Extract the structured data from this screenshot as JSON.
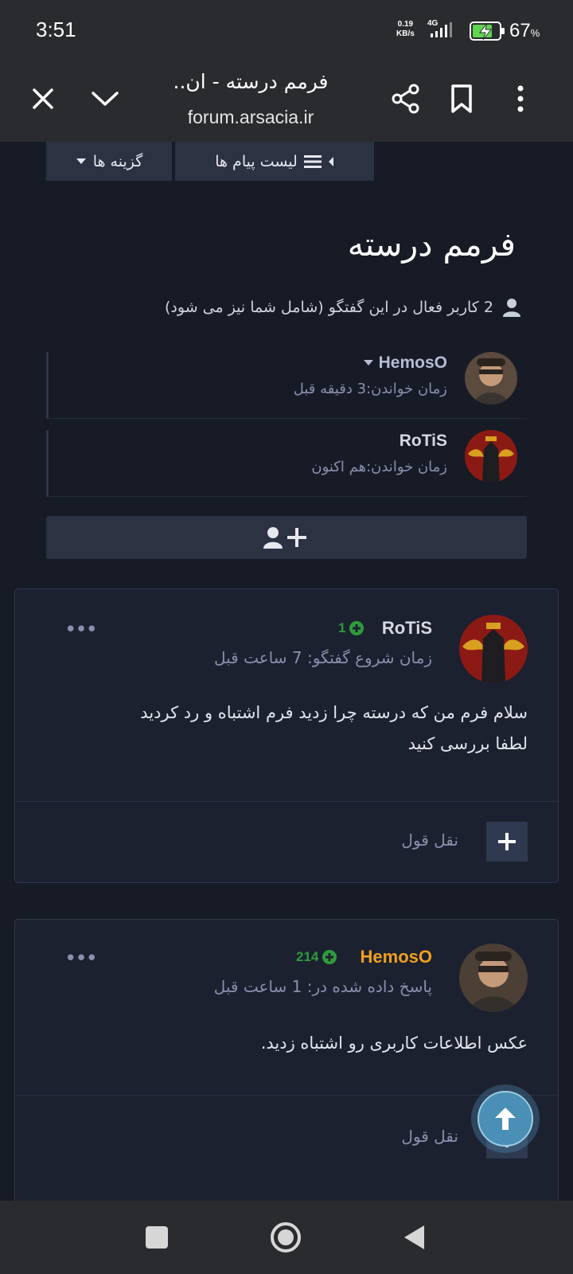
{
  "status": {
    "time": "3:51",
    "speed_value": "0.19",
    "speed_unit": "KB/s",
    "network": "4G",
    "battery": "67",
    "battery_unit": "%"
  },
  "browser": {
    "title": "فرمم درسته - ان..",
    "url": "forum.arsacia.ir",
    "icons": [
      "close-icon",
      "chevron-down-icon",
      "share-icon",
      "bookmark-icon",
      "more-vert-icon"
    ]
  },
  "topbar": {
    "options_label": "گزینه ها",
    "messages_label": "لیست پیام ها"
  },
  "thread": {
    "title": "فرمم درسته",
    "viewers_text": "2 کاربر فعال در این گفتگو (شامل شما نیز می شود)"
  },
  "readers": [
    {
      "name": "HemosO",
      "time": "زمان خواندن:3 دقیقه قبل"
    },
    {
      "name": "RoTiS",
      "time": "زمان خواندن:هم اکنون"
    }
  ],
  "posts": [
    {
      "author": "RoTiS",
      "author_color": "#d6d9e2",
      "score": "1",
      "time": "زمان شروع گفتگو: 7 ساعت قبل",
      "lines": [
        "سلام فرم من که درسته چرا زدید فرم اشتباه و رد کردید",
        "لطفا بررسی کنید"
      ],
      "quote_label": "نقل قول",
      "more": "•••"
    },
    {
      "author": "HemosO",
      "author_color": "#f0a020",
      "score": "214",
      "time": "پاسخ داده شده در: 1 ساعت قبل",
      "lines": [
        "عکس اطلاعات کاربری رو اشتباه زدید."
      ],
      "quote_label": "نقل قول",
      "more": "•••"
    }
  ],
  "colors": {
    "accent_green": "#2e9c3a",
    "accent_orange": "#f0a020",
    "muted": "#8b8fae"
  }
}
